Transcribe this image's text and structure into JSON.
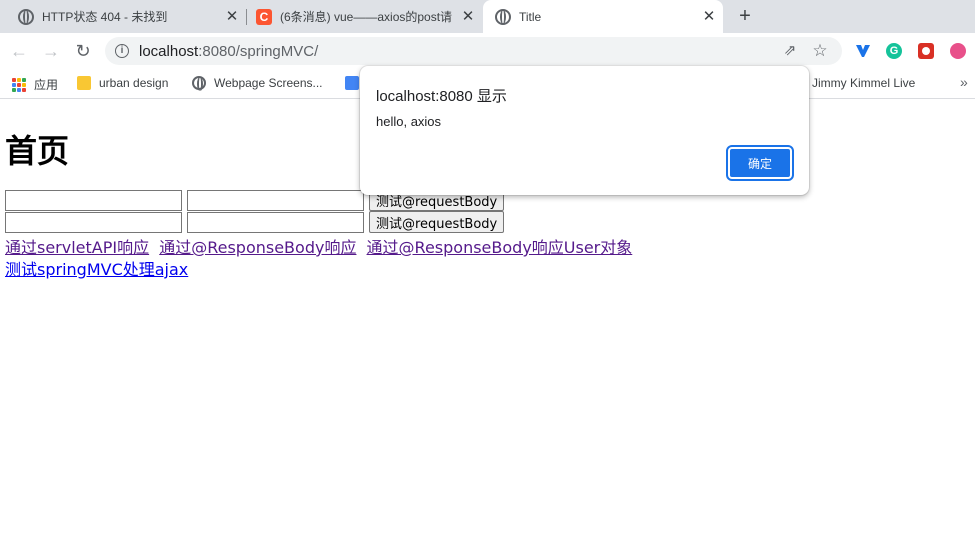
{
  "browser": {
    "tabs": [
      {
        "title": "HTTP状态 404 - 未找到",
        "favicon": "globe-icon"
      },
      {
        "title": "(6条消息) vue——axios的post请",
        "favicon": "csdn-icon"
      },
      {
        "title": "Title",
        "favicon": "globe-icon",
        "active": true
      }
    ],
    "new_tab_label": "+",
    "close_glyph": "✕",
    "address": {
      "host": "localhost",
      "rest": ":8080/springMVC/"
    },
    "bookmarks": [
      {
        "label": "应用",
        "icon": "apps-icon"
      },
      {
        "label": "urban design",
        "icon": "folder-icon"
      },
      {
        "label": "Webpage Screens...",
        "icon": "globe-icon"
      },
      {
        "label": "",
        "icon": "doc-icon"
      },
      {
        "label": "Jimmy Kimmel Live",
        "icon": "none"
      }
    ],
    "more_bookmarks": "»"
  },
  "page": {
    "title": "首页",
    "forms": [
      {
        "username_value": "",
        "password_value": "",
        "button_label": "测试@requestBody"
      },
      {
        "username_value": "",
        "password_value": "",
        "button_label": "测试@requestBody"
      }
    ],
    "links": [
      "通过servletAPI响应",
      "通过@ResponseBody响应",
      "通过@ResponseBody响应User对象"
    ],
    "ajax_link": "测试springMVC处理ajax"
  },
  "dialog": {
    "title": "localhost:8080 显示",
    "message": "hello, axios",
    "ok_label": "确定"
  },
  "colors": {
    "accent": "#1a73e8",
    "visited_link": "#551a8b",
    "link": "#0000ee",
    "tabstrip": "#dee1e6"
  }
}
